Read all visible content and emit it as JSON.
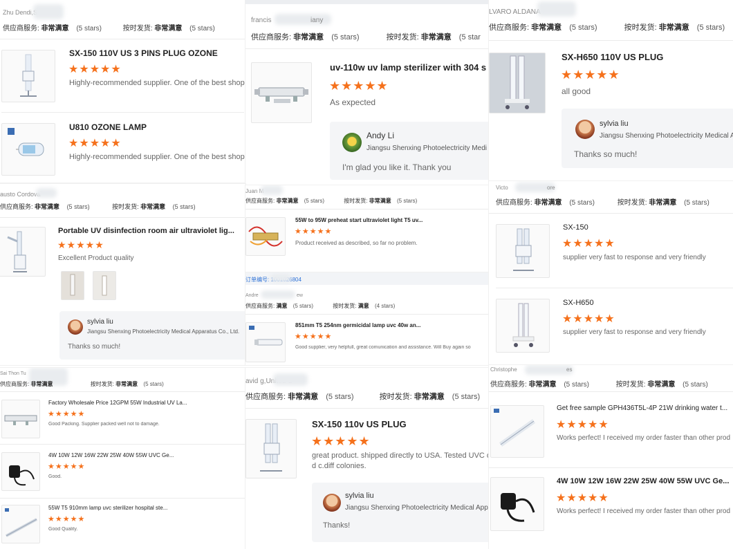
{
  "p1": {
    "header": "Zhu Dendi,Scott",
    "svc_k": "供应商服务:",
    "svc_v": "非常满意",
    "svc_n": "(5 stars)",
    "del_k": "按时发货:",
    "del_v": "非常满意",
    "del_n": "(5 stars)",
    "items": [
      {
        "title": "SX-150 110V US 3 PINS PLUG OZONE",
        "stars": "★★★★★",
        "comment": "Highly-recommended supplier. One of the best shoppin"
      },
      {
        "title": "U810 OZONE LAMP",
        "stars": "★★★★★",
        "comment": "Highly-recommended supplier. One of the best shoppin"
      }
    ]
  },
  "p2": {
    "header": "francis",
    "header2": "iany",
    "svc_k": "供应商服务:",
    "svc_v": "非常满意",
    "svc_n": "(5 stars)",
    "del_k": "按时发货:",
    "del_v": "非常满意",
    "del_n": "(5 star",
    "title": "uv-110w uv lamp sterilizer with 304 s",
    "stars": "★★★★★",
    "comment": "As expected",
    "reply_name": "Andy Li",
    "reply_company": "Jiangsu Shenxing Photoelectricity Medi",
    "reply_text": "I'm glad you like it. Thank you"
  },
  "p3": {
    "header": "LVARO ALDANA",
    "svc_k": "供应商服务:",
    "svc_v": "非常满意",
    "svc_n": "(5 stars)",
    "del_k": "按时发货:",
    "del_v": "非常满意",
    "del_n": "(5 stars)",
    "title": "SX-H650 110V US PLUG",
    "stars": "★★★★★",
    "comment": "all good",
    "reply_name": "sylvia liu",
    "reply_company": "Jiangsu Shenxing Photoelectricity Medical A",
    "reply_text": "Thanks so much!"
  },
  "p4": {
    "header": "austo Cordova",
    "svc_k": "供应商服务:",
    "svc_v": "非常满意",
    "svc_n": "(5 stars)",
    "del_k": "按时发货:",
    "del_v": "非常满意",
    "del_n": "(5 stars)",
    "title": "Portable UV disinfection room air ultraviolet lig...",
    "stars": "★★★★★",
    "comment": "Excellent Product quality",
    "reply_name": "sylvia liu",
    "reply_company": "Jiangsu Shenxing Photoelectricity Medical Apparatus Co., Ltd.",
    "reply_text": "Thanks so much!"
  },
  "p5": {
    "header": "Juan M",
    "svc_k": "供应商服务:",
    "svc_v": "非常满意",
    "svc_n": "(5 stars)",
    "del_k": "按时发货:",
    "del_v": "非常满意",
    "del_n": "(5 stars)",
    "title": "55W to 95W preheat start ultraviolet light T5 uv...",
    "stars": "★★★★★",
    "comment": "Product received as described, so far no problem."
  },
  "p6": {
    "order": "订单编号: 1001026804",
    "header": "Andre",
    "header2": "ew",
    "svc_k": "供应商服务:",
    "svc_v": "满意",
    "svc_n": "(5 stars)",
    "del_k": "按时发货:",
    "del_v": "满意",
    "del_n": "(4 stars)",
    "title": "851mm T5 254nm germicidal lamp uvc 40w an...",
    "stars": "★★★★★",
    "comment": "Good supplier, very helpfull, great comunication and assistance. Will Buy again so"
  },
  "p7": {
    "header": "Victo",
    "header2": "ore",
    "svc_k": "供应商服务:",
    "svc_v": "非常满意",
    "svc_n": "(5 stars)",
    "del_k": "按时发货:",
    "del_v": "非常满意",
    "del_n": "(5 stars)",
    "items": [
      {
        "title": "SX-150",
        "stars": "★★★★★",
        "comment": "supplier very fast to response and very friendly"
      },
      {
        "title": "SX-H650",
        "stars": "★★★★★",
        "comment": "supplier very fast to response and very friendly"
      }
    ]
  },
  "p8": {
    "header": "Sai Thon Tu",
    "svc_k": "供应商服务:",
    "svc_v": "非常满意",
    "svc_n": "",
    "del_k": "按时发货:",
    "del_v": "非常满意",
    "del_n": "(5 stars)",
    "items": [
      {
        "title": "Factory Wholesale Price 12GPM 55W Industrial UV La...",
        "stars": "★★★★★",
        "comment": "Good Packing. Supplier packed well not to damage."
      },
      {
        "title": "4W 10W 12W 16W 22W 25W 40W 55W UVC Ge...",
        "stars": "★★★★★",
        "comment": "Good."
      },
      {
        "title": "55W T5 910mm lamp uvc sterilizer hospital ste...",
        "stars": "★★★★★",
        "comment": "Good Quality."
      }
    ]
  },
  "p9": {
    "header": "avid g,United S",
    "svc_k": "供应商服务:",
    "svc_v": "非常满意",
    "svc_n": "(5 stars)",
    "del_k": "按时发货:",
    "del_v": "非常满意",
    "del_n": "(5 stars)",
    "title": "SX-150 110v US PLUG",
    "stars": "★★★★★",
    "comment1": "great product. shipped directly to USA. Tested UVC o",
    "comment2": "d c.diff colonies.",
    "reply_name": "sylvia liu",
    "reply_company": "Jiangsu Shenxing Photoelectricity Medical Appar",
    "reply_text": "Thanks!"
  },
  "p10": {
    "header": "Christophe",
    "header2": "es",
    "svc_k": "供应商服务:",
    "svc_v": "非常满意",
    "svc_n": "(5 stars)",
    "del_k": "按时发货:",
    "del_v": "非常满意",
    "del_n": "(5 stars)",
    "items": [
      {
        "title": "Get free sample GPH436T5L-4P 21W drinking water t...",
        "stars": "★★★★★",
        "comment": "Works perfect! I received my order faster than other prod"
      },
      {
        "title": "4W 10W 12W 16W 22W 25W 40W 55W UVC Ge...",
        "stars": "★★★★★",
        "comment": "Works perfect! I received my order faster than other prod"
      }
    ]
  }
}
